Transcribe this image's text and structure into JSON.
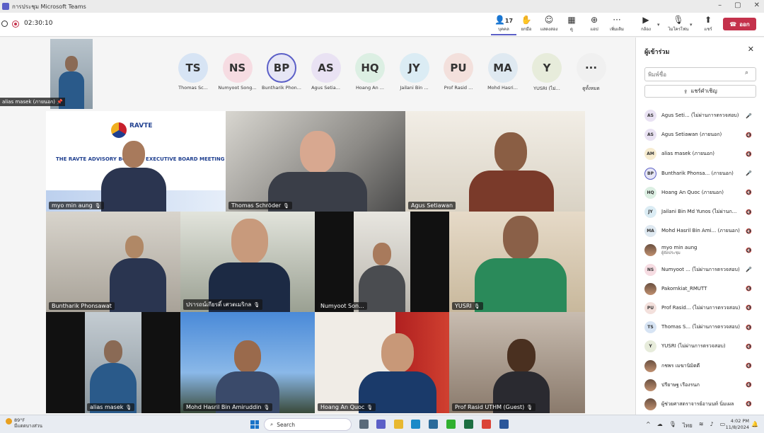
{
  "window": {
    "title": "การประชุม Microsoft Teams",
    "controls": [
      "–",
      "▢",
      "✕"
    ]
  },
  "toolbar": {
    "timer": "02:30:10",
    "people_count": "17",
    "buttons": [
      {
        "label": "บุคคล",
        "icon": "people-icon"
      },
      {
        "label": "ยกมือ",
        "icon": "raise-hand-icon"
      },
      {
        "label": "แสดงสอง",
        "icon": "react-icon"
      },
      {
        "label": "ดู",
        "icon": "view-icon"
      },
      {
        "label": "แอป",
        "icon": "apps-icon"
      },
      {
        "label": "เพิ่มเติม",
        "icon": "more-icon"
      },
      {
        "label": "กล้อง",
        "icon": "camera-icon"
      },
      {
        "label": "ไมโครโฟน",
        "icon": "mic-off-icon"
      },
      {
        "label": "แชร์",
        "icon": "share-icon"
      }
    ],
    "leave_label": "ออก"
  },
  "self_view": {
    "name": "alias masek (ภายนอก)"
  },
  "avatars": [
    {
      "initials": "TS",
      "name": "Thomas Sc...",
      "color": "#d7e4f4"
    },
    {
      "initials": "NS",
      "name": "Numyoot Song...",
      "color": "#f6dce2"
    },
    {
      "initials": "BP",
      "name": "Buntharik Phon...",
      "color": "#e6e6f5"
    },
    {
      "initials": "AS",
      "name": "Agus Setia...",
      "color": "#e9e2f3"
    },
    {
      "initials": "HQ",
      "name": "Hoang An ...",
      "color": "#dcefe3"
    },
    {
      "initials": "JY",
      "name": "Jailani Bin ...",
      "color": "#dbecf4"
    },
    {
      "initials": "PU",
      "name": "Prof Rasid ...",
      "color": "#f3e0dc"
    },
    {
      "initials": "MA",
      "name": "Mohd Hasri...",
      "color": "#dfe9f1"
    },
    {
      "initials": "Y",
      "name": "YUSRI (ไม่...",
      "color": "#e7ecdb"
    },
    {
      "initials": "···",
      "name": "ดูทั้งหมด",
      "color": "#f0f0f0"
    }
  ],
  "banner": {
    "brand": "RAVTE",
    "headline": "THE RAVTE ADVISORY BOARD & EXECUTIVE BOARD MEETING 2024"
  },
  "tiles": [
    {
      "name": "myo min aung"
    },
    {
      "name": "Thomas Schröder"
    },
    {
      "name": "Agus Setiawan"
    },
    {
      "name": "Buntharik Phonsawat"
    },
    {
      "name": "ปรารถน์เกียรติ์ เศวตเมริกล"
    },
    {
      "name": "Numyoot Son..."
    },
    {
      "name": "YUSRI"
    },
    {
      "name": "alias masek"
    },
    {
      "name": "Mohd Hasril Bin Amiruddin"
    },
    {
      "name": "Hoang An Quoc"
    },
    {
      "name": "Prof Rasid UTHM (Guest)"
    }
  ],
  "panel": {
    "title": "ผู้เข้าร่วม",
    "search_placeholder": "พิมพ์ชื่อ",
    "invite_label": "แชร์คำเชิญ",
    "participants": [
      {
        "initials": "AS",
        "name": "Agus Seti... (ไม่ผ่านการตรวจสอบ)",
        "color": "#e9e2f3",
        "status": "🎤"
      },
      {
        "initials": "AS",
        "name": "Agus Setiawan (ภายนอก)",
        "color": "#e9e2f3",
        "status": "🔇"
      },
      {
        "initials": "AM",
        "name": "alias masek (ภายนอก)",
        "color": "#f7ecd0",
        "status": "🔇"
      },
      {
        "initials": "BP",
        "name": "Buntharik Phonsa... (ภายนอก)",
        "color": "#e6e6f5",
        "status": "🎤"
      },
      {
        "initials": "HQ",
        "name": "Hoang An Quoc (ภายนอก)",
        "color": "#dcefe3",
        "status": "🔇"
      },
      {
        "initials": "JY",
        "name": "Jailani Bin Md Yunos (ไม่ผ่านก...",
        "color": "#dbecf4",
        "status": "🔇"
      },
      {
        "initials": "MA",
        "name": "Mohd Hasril Bin Ami... (ภายนอก)",
        "color": "#dfe9f1",
        "status": "🔇"
      },
      {
        "initials": "MM",
        "name": "myo min aung",
        "sub": "ผู้จัดประชุม",
        "color": "#5a6a80",
        "status": "🔇",
        "photo": true
      },
      {
        "initials": "NS",
        "name": "Numyoot ... (ไม่ผ่านการตรวจสอบ)",
        "color": "#f6dce2",
        "status": "🎤"
      },
      {
        "initials": "PK",
        "name": "Pakornkiat_RMUTT",
        "color": "#c09070",
        "status": "🔇",
        "photo": true
      },
      {
        "initials": "PU",
        "name": "Prof Rasid... (ไม่ผ่านการตรวจสอบ)",
        "color": "#f3e0dc",
        "status": "🔇"
      },
      {
        "initials": "TS",
        "name": "Thomas S... (ไม่ผ่านการตรวจสอบ)",
        "color": "#d7e4f4",
        "status": "🔇"
      },
      {
        "initials": "Y",
        "name": "YUSRI (ไม่ผ่านการตรวจสอบ)",
        "color": "#e7ecdb",
        "status": "🔇"
      },
      {
        "initials": "กพ",
        "name": "กชพร เมฆานิมิตดี",
        "color": "#c09070",
        "status": "🔇",
        "photo": true
      },
      {
        "initials": "ปร",
        "name": "ปรียาษฐ เรืองรนภ",
        "color": "#c09070",
        "status": "🔇",
        "photo": true
      },
      {
        "initials": "ผศ",
        "name": "ผู้ช่วยศาสตราจารย์อานนท์ นิ่มเผล",
        "color": "#c09070",
        "status": "🔇",
        "photo": true
      }
    ]
  },
  "taskbar": {
    "weather_temp": "89°F",
    "weather_desc": "มีแดดบางส่วน",
    "search_label": "Search",
    "lang": "ไทย",
    "time": "4:02 PM",
    "date": "11/8/2024"
  }
}
